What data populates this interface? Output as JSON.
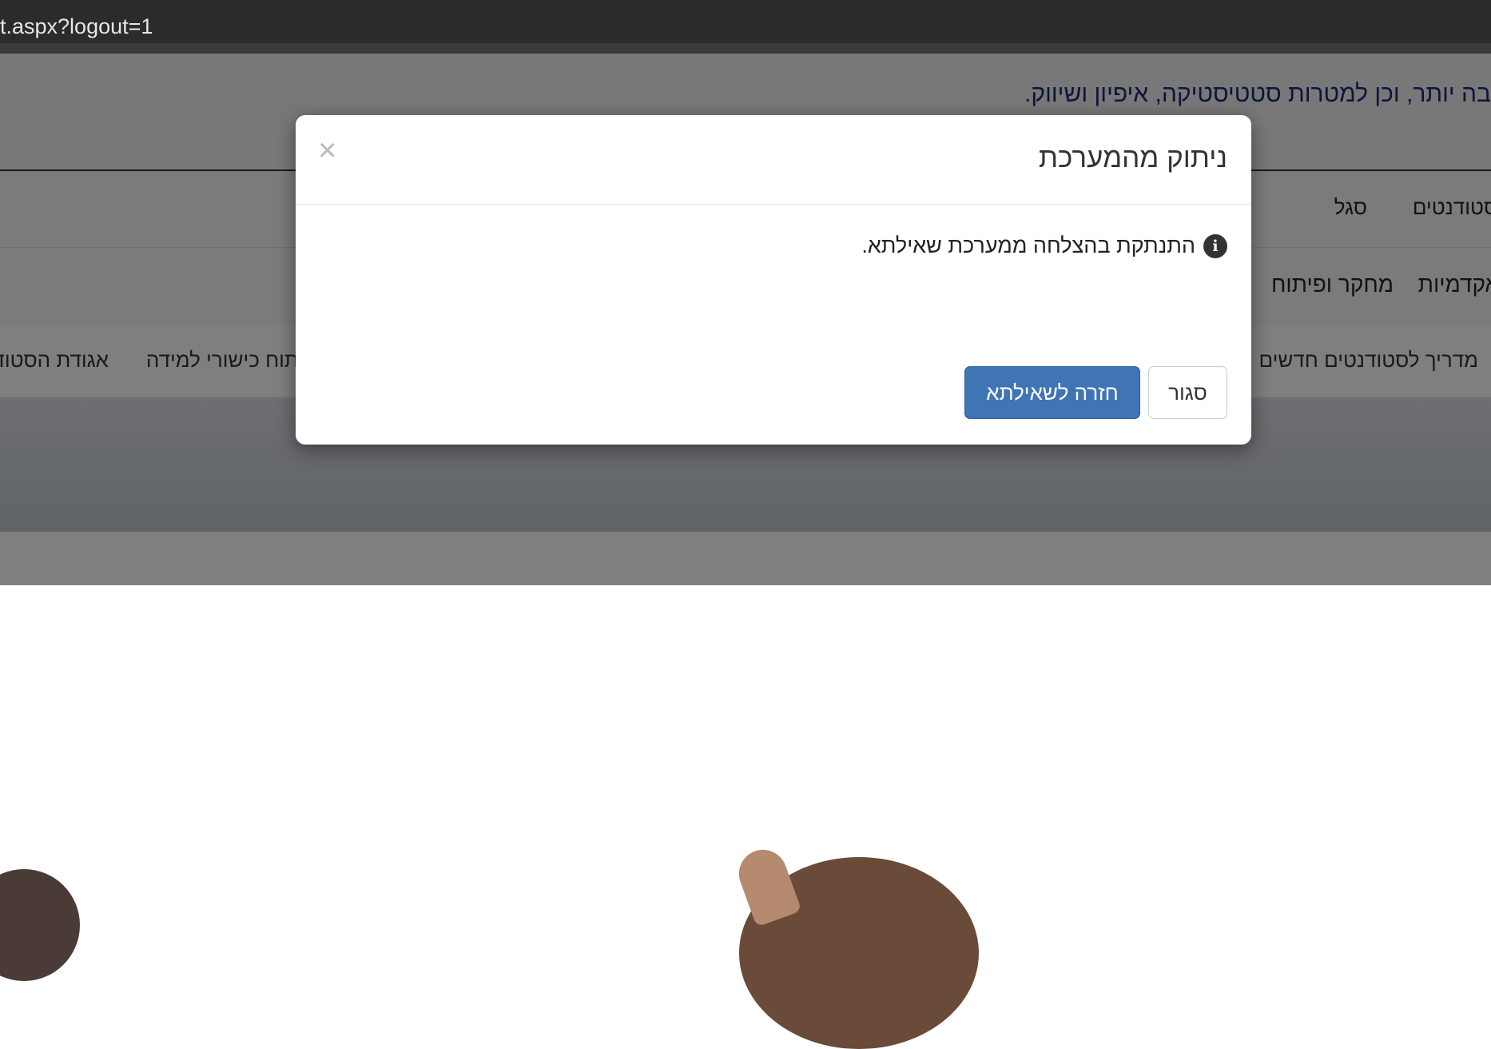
{
  "browser": {
    "url_fragment": "t.aspx?logout=1"
  },
  "cookie_banner": {
    "text": "בה יותר, וכן למטרות סטטיסטיקה, איפיון ושיווק."
  },
  "nav_top": {
    "items": [
      "סטודנטים",
      "סגל"
    ]
  },
  "nav_main": {
    "items": [
      "אקדמיות",
      "מחקר ופיתוח"
    ]
  },
  "nav_sub": {
    "items": [
      "מדריך לסטודנטים חדשים",
      "פיתוח כישורי למידה",
      "אגודת הסטודנטים"
    ]
  },
  "modal": {
    "title": "ניתוק מהמערכת",
    "close_symbol": "×",
    "info_symbol": "i",
    "message": "התנתקת בהצלחה ממערכת שאילתא.",
    "close_label": "סגור",
    "return_label": "חזרה לשאילתא"
  },
  "colors": {
    "primary_button": "#3f74b5",
    "overlay": "rgba(0,0,0,0.5)",
    "banner_text": "#1a2a78"
  }
}
